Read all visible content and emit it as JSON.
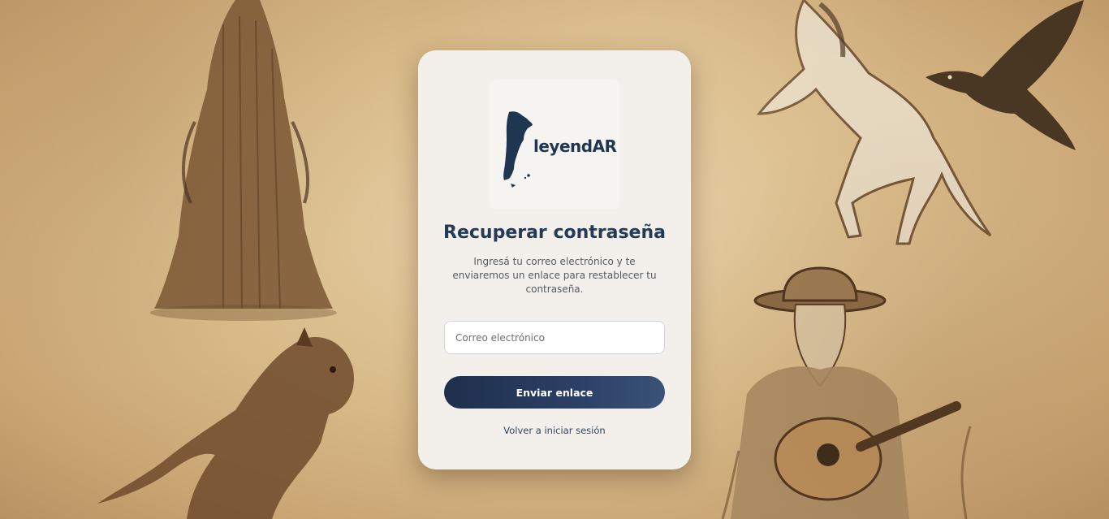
{
  "brand": {
    "name": "leyendAR"
  },
  "form": {
    "title": "Recuperar contraseña",
    "subtitle": "Ingresá tu correo electrónico y te enviaremos un enlace para restablecer tu contraseña.",
    "email_placeholder": "Correo electrónico",
    "email_value": "",
    "submit_label": "Enviar enlace",
    "back_link_label": "Volver a iniciar sesión"
  },
  "background": {
    "illustrations": [
      "cloaked-ghost-illustration",
      "werewolf-illustration",
      "rearing-horse-illustration",
      "crow-illustration",
      "gaucho-guitarist-illustration"
    ]
  },
  "colors": {
    "accent": "#243a57",
    "button_start": "#1f2f4d",
    "button_end": "#3a5278",
    "card_bg": "#f3f0ec",
    "page_bg": "#d9bb8a"
  }
}
